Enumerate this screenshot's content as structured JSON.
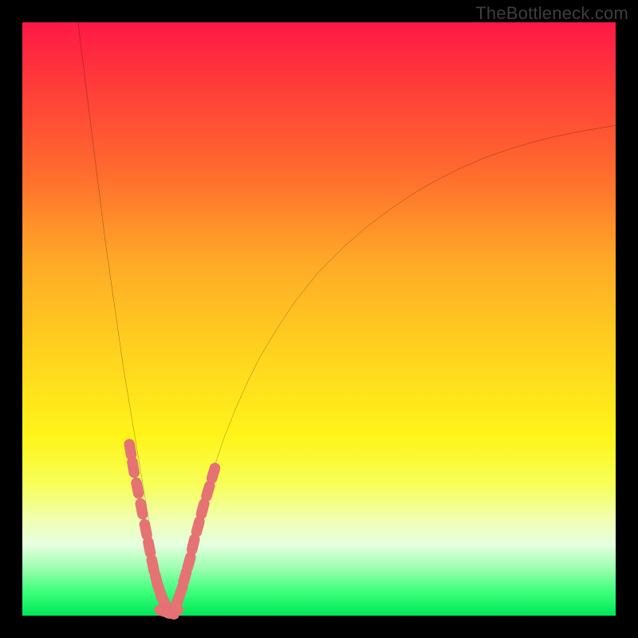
{
  "watermark": "TheBottleneck.com",
  "colors": {
    "frame": "#000000",
    "curve_stroke": "#000000",
    "marker_fill": "#e57373",
    "marker_stroke": "#c24f4f",
    "gradient_top": "#ff1846",
    "gradient_bottom": "#00e857"
  },
  "chart_data": {
    "type": "line",
    "title": "",
    "xlabel": "",
    "ylabel": "",
    "xlim": [
      0,
      100
    ],
    "ylim": [
      0,
      100
    ],
    "grid": false,
    "legend": false,
    "note": "Values are positions in percent of plot area; y increases downward as rendered (0=top, 100=bottom). The curve shows a V-shaped dip reaching the bottom (y≈100) near x≈24.",
    "series": [
      {
        "name": "curve",
        "x": [
          9.4,
          10,
          11,
          12,
          13,
          14,
          15,
          16,
          17,
          18,
          19,
          20,
          21,
          22,
          22.5,
          23,
          23.5,
          24,
          25,
          25.5,
          26,
          27,
          28,
          29,
          30,
          31,
          32,
          34,
          36,
          38,
          40,
          43,
          46,
          50,
          54,
          58,
          62,
          66,
          70,
          74,
          78,
          82,
          86,
          90,
          94,
          98,
          100
        ],
        "y": [
          0,
          5,
          13,
          21,
          29,
          37,
          44,
          51,
          58,
          64,
          70,
          76,
          82,
          88,
          91,
          94,
          96.5,
          98.5,
          99.6,
          99.6,
          98.5,
          95,
          91,
          87,
          83,
          79.5,
          76,
          70,
          65,
          60.5,
          56.5,
          51.5,
          47,
          42,
          38,
          34.5,
          31.5,
          28.8,
          26.5,
          24.5,
          22.8,
          21.4,
          20.2,
          19.2,
          18.4,
          17.7,
          17.4
        ]
      },
      {
        "name": "markers-left",
        "x": [
          18.2,
          18.7,
          19.4,
          20.1,
          20.8,
          21.4,
          22.0,
          22.6,
          23.2,
          23.8,
          24.4
        ],
        "y": [
          72.0,
          75.0,
          78.5,
          82.0,
          85.5,
          88.5,
          91.5,
          94.0,
          96.0,
          97.5,
          98.8
        ]
      },
      {
        "name": "markers-bottom",
        "x": [
          24.0,
          24.7,
          25.4
        ],
        "y": [
          99.3,
          99.5,
          99.3
        ]
      },
      {
        "name": "markers-right",
        "x": [
          26.0,
          26.7,
          27.4,
          28.1,
          28.8,
          29.6,
          30.4,
          31.3,
          32.2
        ],
        "y": [
          98.0,
          96.0,
          93.5,
          91.0,
          88.0,
          85.0,
          82.0,
          79.0,
          76.0
        ]
      }
    ]
  }
}
